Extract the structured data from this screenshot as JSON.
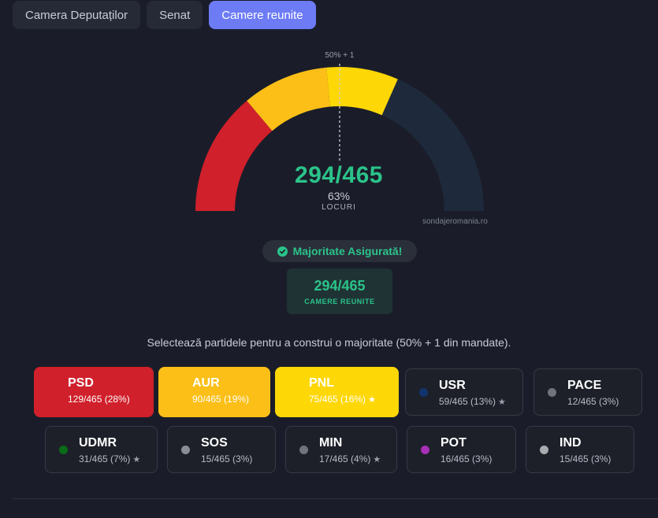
{
  "tabs": [
    {
      "label": "Camera Deputaților",
      "active": false
    },
    {
      "label": "Senat",
      "active": false
    },
    {
      "label": "Camere reunite",
      "active": true
    }
  ],
  "gauge": {
    "total": 465,
    "half_label": "50% + 1",
    "seats_display": "294/465",
    "percent": "63%",
    "unit_label": "LOCURI",
    "watermark": "sondajeromania.ro",
    "segments": [
      {
        "party": "PSD",
        "seats": 129,
        "color": "#d0202b"
      },
      {
        "party": "AUR",
        "seats": 90,
        "color": "#fbbf17"
      },
      {
        "party": "PNL",
        "seats": 75,
        "color": "#fed707"
      }
    ],
    "remainder_color": "#1e2a3b"
  },
  "majority": {
    "label": "Majoritate Asigurată!"
  },
  "summary": {
    "value": "294/465",
    "label": "CAMERE REUNITE"
  },
  "instruction": "Selectează partidele pentru a construi o majoritate (50% + 1 din mandate).",
  "parties": [
    {
      "name": "PSD",
      "seats": "129/465 (28%)",
      "selected": true,
      "color": "#d0202b"
    },
    {
      "name": "AUR",
      "seats": "90/465 (19%)",
      "selected": true,
      "color": "#fbbf17"
    },
    {
      "name": "PNL",
      "seats": "75/465 (16%)",
      "selected": true,
      "color": "#fed707",
      "star": true
    },
    {
      "name": "USR",
      "seats": "59/465 (13%)",
      "selected": false,
      "color": "#11346e",
      "star": true
    },
    {
      "name": "PACE",
      "seats": "12/465 (3%)",
      "selected": false,
      "color": "#6f737d"
    },
    {
      "name": "UDMR",
      "seats": "31/465 (7%)",
      "selected": false,
      "color": "#0a6b18",
      "star": true
    },
    {
      "name": "SOS",
      "seats": "15/465 (3%)",
      "selected": false,
      "color": "#8a8d94"
    },
    {
      "name": "MIN",
      "seats": "17/465 (4%)",
      "selected": false,
      "color": "#6f737d",
      "star": true
    },
    {
      "name": "POT",
      "seats": "16/465 (3%)",
      "selected": false,
      "color": "#a62fb5"
    },
    {
      "name": "IND",
      "seats": "15/465 (3%)",
      "selected": false,
      "color": "#a9abb0"
    }
  ],
  "icons": {
    "check": "check-circle-icon",
    "star": "star-icon"
  }
}
